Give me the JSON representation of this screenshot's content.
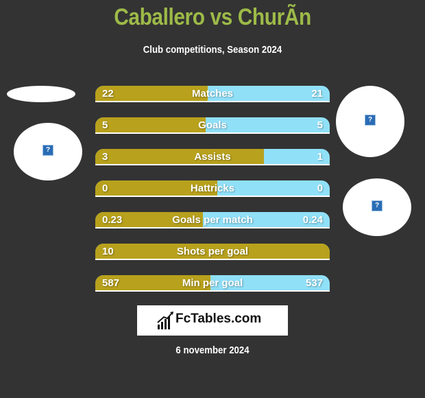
{
  "header": {
    "title": "Caballero vs ChurÃn",
    "subtitle": "Club competitions, Season 2024"
  },
  "colors": {
    "left": "#b8a11c",
    "right": "#90e0f8",
    "title": "#9dba48",
    "background": "#333333"
  },
  "stats": [
    {
      "label": "Matches",
      "left": "22",
      "right": "21",
      "left_share": 0.48
    },
    {
      "label": "Goals",
      "left": "5",
      "right": "5",
      "left_share": 0.47
    },
    {
      "label": "Assists",
      "left": "3",
      "right": "1",
      "left_share": 0.72
    },
    {
      "label": "Hattricks",
      "left": "0",
      "right": "0",
      "left_share": 0.52
    },
    {
      "label": "Goals per match",
      "left": "0.23",
      "right": "0.24",
      "left_share": 0.46
    },
    {
      "label": "Shots per goal",
      "left": "10",
      "right": "",
      "left_share": 1.0
    },
    {
      "label": "Min per goal",
      "left": "587",
      "right": "537",
      "left_share": 0.49
    }
  ],
  "placeholders": {
    "icon": "?"
  },
  "footer": {
    "logo": "FcTables.com",
    "date": "6 november 2024"
  }
}
